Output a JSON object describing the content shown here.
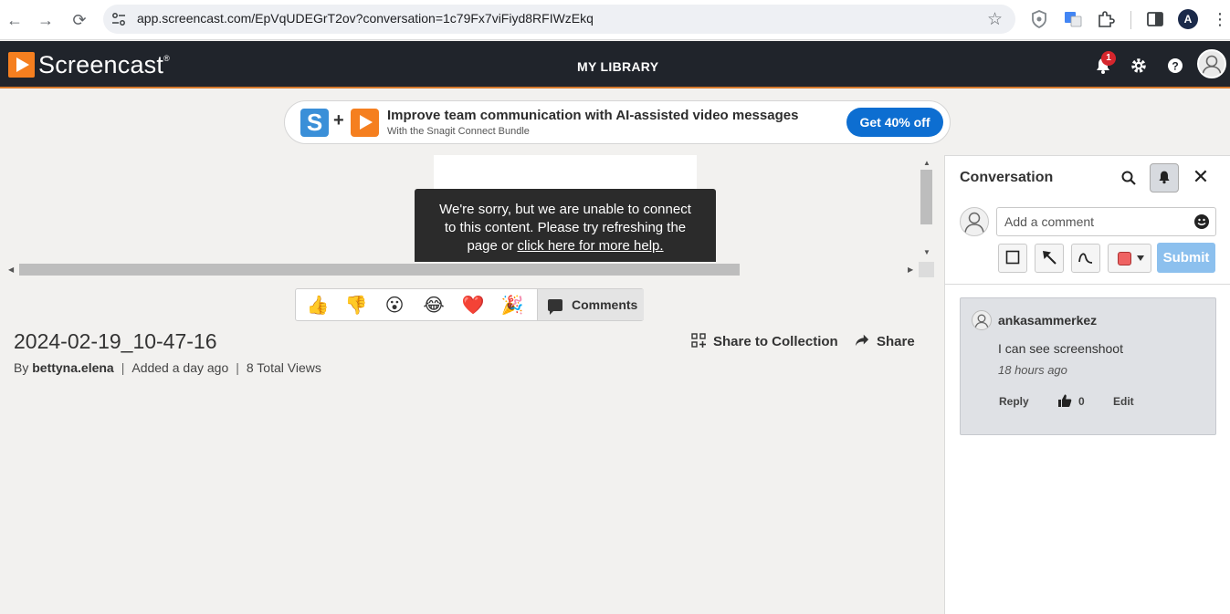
{
  "browser": {
    "url": "app.screencast.com/EpVqUDEGrT2ov?conversation=1c79Fx7viFiyd8RFIWzEkq",
    "profile_initial": "A"
  },
  "header": {
    "logo_text": "Screencast",
    "logo_mark": "®",
    "title": "MY LIBRARY",
    "notification_count": "1"
  },
  "promo": {
    "headline": "Improve team communication with AI-assisted video messages",
    "subline": "With the Snagit Connect Bundle",
    "cta_label": "Get 40% off",
    "plus": "+",
    "s_letter": "S"
  },
  "player": {
    "error_line1": "We're sorry, but we are unable to connect",
    "error_line2": "to this content. Please try refreshing the",
    "error_line3_prefix": "page or ",
    "error_link": "click here for more help."
  },
  "reactions": {
    "items": [
      "👍",
      "👎",
      "😮",
      "😂",
      "❤️",
      "🎉"
    ],
    "comments_label": "Comments"
  },
  "video": {
    "title": "2024-02-19_10-47-16",
    "by_label": "By",
    "author": "bettyna.elena",
    "added": "Added a day ago",
    "views": "8 Total Views",
    "share_collection": "Share to Collection",
    "share": "Share"
  },
  "conversation": {
    "title": "Conversation",
    "comment_placeholder": "Add a comment",
    "submit_label": "Submit",
    "annotation_color": "#ef6262",
    "comments": [
      {
        "author": "ankasammerkez",
        "text": "I can see screenshoot",
        "time": "18 hours ago",
        "reply_label": "Reply",
        "likes": "0",
        "edit_label": "Edit"
      }
    ]
  },
  "colors": {
    "header_bg": "#20242b",
    "accent_orange": "#f57f1f",
    "cta_blue": "#0d6ed1",
    "submit_blue": "#8cc0ee"
  }
}
